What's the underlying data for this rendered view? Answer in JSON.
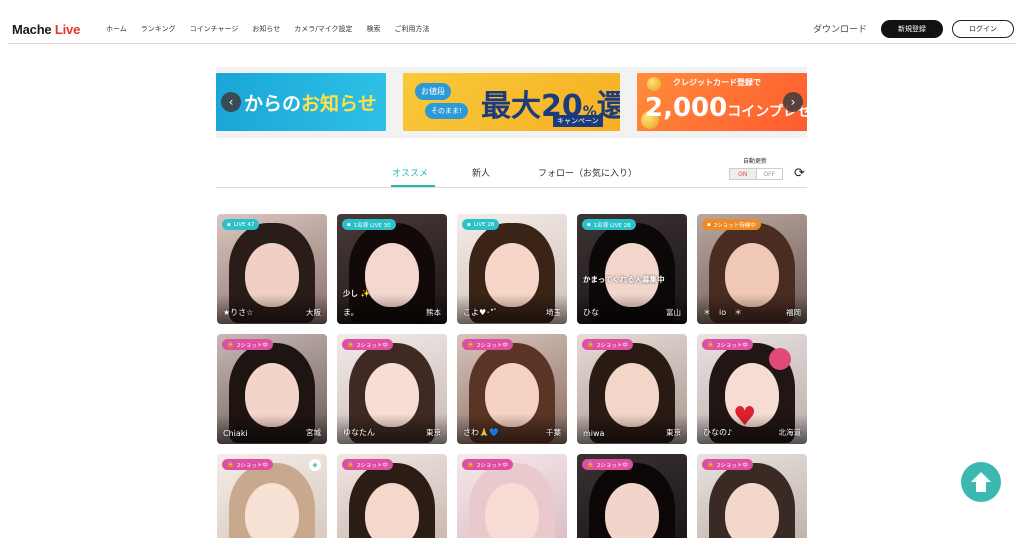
{
  "header": {
    "logo": {
      "part1": "Mache",
      "part2": "Live"
    },
    "nav": [
      "ホーム",
      "ランキング",
      "コインチャージ",
      "お知らせ",
      "カメラ/マイク設定",
      "検索",
      "ご利用方法"
    ],
    "download": "ダウンロード",
    "register": "新規登録",
    "login": "ログイン"
  },
  "banners": {
    "b1": {
      "text_a": "からの",
      "text_b": "お知らせ"
    },
    "b2": {
      "bubble1": "お値段",
      "bubble2": "そのまま!",
      "main": "最大20",
      "percent": "%",
      "tail": "還元",
      "campaign": "キャンペーン"
    },
    "b3": {
      "top": "クレジットカード登録で",
      "main": "2,000",
      "unit": "コインプレゼ"
    },
    "prev": "‹",
    "next": "›"
  },
  "tabs": {
    "items": [
      "オススメ",
      "新人",
      "フォロー（お気に入り）"
    ],
    "active": 0,
    "auto_update_label": "自動更新",
    "toggle_on": "ON",
    "toggle_off": "OFF"
  },
  "cards": [
    {
      "badge": "LIVE  47",
      "badge_type": "live",
      "name": "★りさ☆",
      "loc": "大阪",
      "caption": ""
    },
    {
      "badge": "1名様 LIVE  30",
      "badge_type": "live",
      "name": "ま。",
      "loc": "熊本",
      "caption": "少し ✨"
    },
    {
      "badge": "LIVE  28",
      "badge_type": "live",
      "name": "こよ♥︎･*ﾟ",
      "loc": "埼玉",
      "caption": ""
    },
    {
      "badge": "1名様 LIVE  28",
      "badge_type": "live",
      "name": "ひな",
      "loc": "富山",
      "caption": "かまってくれる人募集中"
    },
    {
      "badge": "2ショット待機中",
      "badge_type": "twofeat",
      "name": "＊　io　＊",
      "loc": "福岡",
      "caption": ""
    },
    {
      "badge": "2ショット中",
      "badge_type": "two",
      "name": "Chiaki",
      "loc": "宮城",
      "caption": ""
    },
    {
      "badge": "2ショット中",
      "badge_type": "two",
      "name": "ゆなたん",
      "loc": "東京",
      "caption": ""
    },
    {
      "badge": "2ショット中",
      "badge_type": "two",
      "name": "さわ🙏💙",
      "loc": "千葉",
      "caption": ""
    },
    {
      "badge": "2ショット中",
      "badge_type": "two",
      "name": "miwa",
      "loc": "東京",
      "caption": ""
    },
    {
      "badge": "2ショット中",
      "badge_type": "two",
      "name": "ひなの♪",
      "loc": "北海道",
      "caption": ""
    },
    {
      "badge": "2ショット中",
      "badge_type": "two",
      "name": "",
      "loc": "",
      "caption": ""
    },
    {
      "badge": "2ショット中",
      "badge_type": "two",
      "name": "",
      "loc": "",
      "caption": ""
    },
    {
      "badge": "2ショット中",
      "badge_type": "two",
      "name": "",
      "loc": "",
      "caption": ""
    },
    {
      "badge": "2ショット中",
      "badge_type": "two",
      "name": "",
      "loc": "",
      "caption": ""
    },
    {
      "badge": "2ショット中",
      "badge_type": "two",
      "name": "",
      "loc": "",
      "caption": ""
    }
  ],
  "colors": {
    "accent": "#2bb5b0",
    "live_badge": "#2bc1c9",
    "two_badge": "#e04ea3",
    "two_wait_badge": "#f08a24"
  }
}
